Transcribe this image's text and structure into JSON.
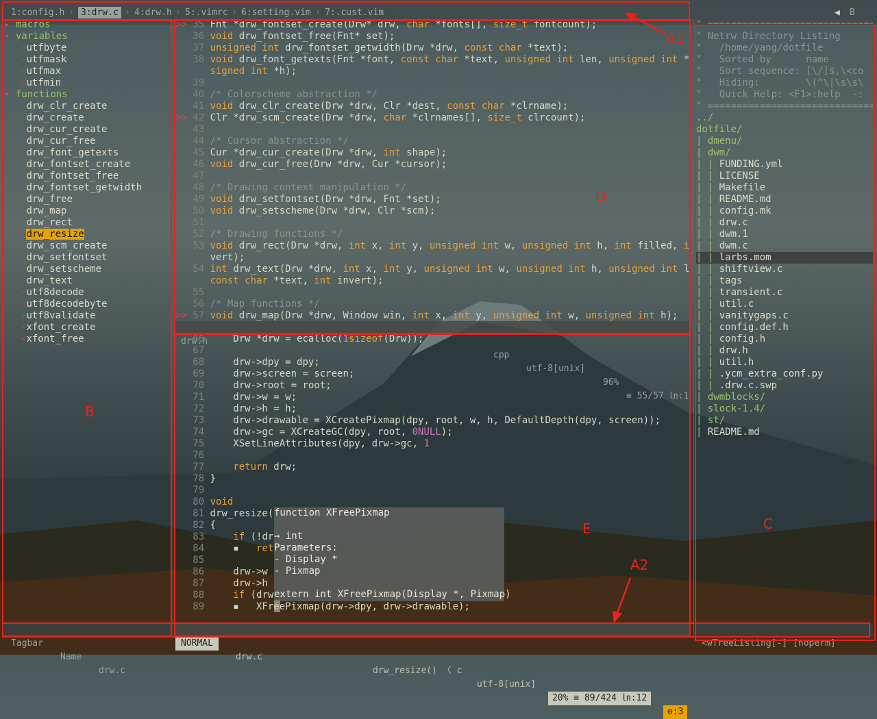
{
  "tabs": [
    {
      "label": "1:config.h",
      "active": false
    },
    {
      "label": "3:drw.c",
      "active": true
    },
    {
      "label": "4:drw.h",
      "active": false
    },
    {
      "label": "5:.vimrc",
      "active": false
    },
    {
      "label": "6:setting.vim",
      "active": false
    },
    {
      "label": "7:.cust.vim",
      "active": false
    }
  ],
  "tab_right": "B",
  "tagbar": {
    "groups": [
      {
        "label": "macros",
        "open": false
      },
      {
        "label": "variables",
        "open": true
      },
      {
        "label": "functions",
        "open": true
      }
    ],
    "variables": [
      "utfbyte",
      "utfmask",
      "utfmax",
      "utfmin"
    ],
    "functions": [
      "drw_clr_create",
      "drw_create",
      "drw_cur_create",
      "drw_cur_free",
      "drw_font_getexts",
      "drw_fontset_create",
      "drw_fontset_free",
      "drw_fontset_getwidth",
      "drw_free",
      "drw_map",
      "drw_rect",
      "drw_resize",
      "drw_scm_create",
      "drw_setfontset",
      "drw_setscheme",
      "drw_text",
      "utf8decode",
      "utf8decodebyte",
      "utf8validate",
      "xfont_create",
      "xfont_free"
    ],
    "highlighted": "drw_resize",
    "status": {
      "name": "Tagbar",
      "label": "Name",
      "file": "drw.c"
    }
  },
  "top_window": {
    "lines": [
      {
        "n": "35",
        "sign": ">>",
        "segs": [
          [
            "",
            "Fnt *drw_fontset_create(Drw* drw, "
          ],
          [
            "kw",
            "char"
          ],
          [
            "",
            " *fonts[], "
          ],
          [
            "kw",
            "size_t"
          ],
          [
            "",
            " fontcount);"
          ]
        ]
      },
      {
        "n": "36",
        "segs": [
          [
            "kw",
            "void"
          ],
          [
            "",
            " drw_fontset_free(Fnt* set);"
          ]
        ]
      },
      {
        "n": "37",
        "segs": [
          [
            "kw",
            "unsigned int"
          ],
          [
            "",
            " drw_fontset_getwidth(Drw *drw, "
          ],
          [
            "kw",
            "const char"
          ],
          [
            "",
            " *text);"
          ]
        ]
      },
      {
        "n": "38",
        "segs": [
          [
            "kw",
            "void"
          ],
          [
            "",
            " drw_font_getexts(Fnt *font, "
          ],
          [
            "kw",
            "const char"
          ],
          [
            "",
            " *text, "
          ],
          [
            "kw",
            "unsigned int"
          ],
          [
            "",
            " len, "
          ],
          [
            "kw",
            "unsigned int"
          ],
          [
            "",
            " *w, un"
          ]
        ]
      },
      {
        "n": "",
        "segs": [
          [
            "kw",
            "signed int"
          ],
          [
            "",
            " *h);"
          ]
        ]
      },
      {
        "n": "39",
        "segs": []
      },
      {
        "n": "40",
        "segs": [
          [
            "cm",
            "/* Colorscheme abstraction */"
          ]
        ]
      },
      {
        "n": "41",
        "segs": [
          [
            "kw",
            "void"
          ],
          [
            "",
            " drw_clr_create(Drw *drw, Clr *dest, "
          ],
          [
            "kw",
            "const char"
          ],
          [
            "",
            " *clrname);"
          ]
        ]
      },
      {
        "n": "42",
        "sign": ">>",
        "segs": [
          [
            "",
            "Clr *drw_scm_create(Drw *drw, "
          ],
          [
            "kw",
            "char"
          ],
          [
            "",
            " *clrnames[], "
          ],
          [
            "kw",
            "size_t"
          ],
          [
            "",
            " clrcount);"
          ]
        ]
      },
      {
        "n": "43",
        "segs": []
      },
      {
        "n": "44",
        "segs": [
          [
            "cm",
            "/* Cursor abstraction */"
          ]
        ]
      },
      {
        "n": "45",
        "segs": [
          [
            "",
            "Cur *drw_cur_create(Drw *drw, "
          ],
          [
            "kw",
            "int"
          ],
          [
            "",
            " shape);"
          ]
        ]
      },
      {
        "n": "46",
        "segs": [
          [
            "kw",
            "void"
          ],
          [
            "",
            " drw_cur_free(Drw *drw, Cur *cursor);"
          ]
        ]
      },
      {
        "n": "47",
        "segs": []
      },
      {
        "n": "48",
        "segs": [
          [
            "cm",
            "/* Drawing context manipulation */"
          ]
        ]
      },
      {
        "n": "49",
        "segs": [
          [
            "kw",
            "void"
          ],
          [
            "",
            " drw_setfontset(Drw *drw, Fnt *set);"
          ]
        ]
      },
      {
        "n": "50",
        "segs": [
          [
            "kw",
            "void"
          ],
          [
            "",
            " drw_setscheme(Drw *drw, Clr *scm);"
          ]
        ]
      },
      {
        "n": "51",
        "segs": []
      },
      {
        "n": "52",
        "segs": [
          [
            "cm",
            "/* Drawing functions */"
          ]
        ]
      },
      {
        "n": "53",
        "segs": [
          [
            "kw",
            "void"
          ],
          [
            "",
            " drw_rect(Drw *drw, "
          ],
          [
            "kw",
            "int"
          ],
          [
            "",
            " x, "
          ],
          [
            "kw",
            "int"
          ],
          [
            "",
            " y, "
          ],
          [
            "kw",
            "unsigned int"
          ],
          [
            "",
            " w, "
          ],
          [
            "kw",
            "unsigned int"
          ],
          [
            "",
            " h, "
          ],
          [
            "kw",
            "int"
          ],
          [
            "",
            " filled, "
          ],
          [
            "kw",
            "int"
          ],
          [
            "",
            " in"
          ]
        ]
      },
      {
        "n": "",
        "segs": [
          [
            "",
            "vert);"
          ]
        ]
      },
      {
        "n": "54",
        "segs": [
          [
            "kw",
            "int"
          ],
          [
            "",
            " drw_text(Drw *drw, "
          ],
          [
            "kw",
            "int"
          ],
          [
            "",
            " x, "
          ],
          [
            "kw",
            "int"
          ],
          [
            "",
            " y, "
          ],
          [
            "kw",
            "unsigned int"
          ],
          [
            "",
            " w, "
          ],
          [
            "kw",
            "unsigned int"
          ],
          [
            "",
            " h, "
          ],
          [
            "kw",
            "unsigned int"
          ],
          [
            "",
            " lpad,"
          ]
        ]
      },
      {
        "n": "",
        "segs": [
          [
            "kw",
            "const char"
          ],
          [
            "",
            " *text, "
          ],
          [
            "kw",
            "int"
          ],
          [
            "",
            " invert);"
          ]
        ]
      },
      {
        "n": "55",
        "segs": []
      },
      {
        "n": "56",
        "segs": [
          [
            "cm",
            "/* Map functions */"
          ]
        ]
      },
      {
        "n": "57",
        "sign": ">>",
        "segs": [
          [
            "kw",
            "void"
          ],
          [
            "",
            " drw_map(Drw *drw, Window win, "
          ],
          [
            "kw",
            "int"
          ],
          [
            "",
            " x, "
          ],
          [
            "kw",
            "int"
          ],
          [
            "",
            " y, "
          ],
          [
            "kw",
            "unsigned int"
          ],
          [
            "",
            " w, "
          ],
          [
            "kw",
            "unsigned int"
          ],
          [
            "",
            " h);"
          ]
        ]
      }
    ],
    "status": {
      "file": "drw.h",
      "ft": "cpp",
      "enc": "utf-8[unix]",
      "pct": "96%",
      "pos": "≡ 55/57 ㏑:1"
    }
  },
  "bottom_window": {
    "lines": [
      {
        "n": "66",
        "segs": [
          [
            "",
            "    Drw *drw = ecalloc("
          ],
          [
            "num",
            "1"
          ],
          [
            ", "
          ],
          [
            "kw",
            "sizeof"
          ],
          [
            "",
            "(Drw));"
          ]
        ]
      },
      {
        "n": "67",
        "segs": []
      },
      {
        "n": "68",
        "segs": [
          [
            "",
            "    drw->dpy = dpy;"
          ]
        ]
      },
      {
        "n": "69",
        "segs": [
          [
            "",
            "    drw->screen = screen;"
          ]
        ]
      },
      {
        "n": "70",
        "segs": [
          [
            "",
            "    drw->root = root;"
          ]
        ]
      },
      {
        "n": "71",
        "segs": [
          [
            "",
            "    drw->w = w;"
          ]
        ]
      },
      {
        "n": "72",
        "segs": [
          [
            "",
            "    drw->h = h;"
          ]
        ]
      },
      {
        "n": "73",
        "segs": [
          [
            "",
            "    drw->drawable = XCreatePixmap(dpy, root, w, h, DefaultDepth(dpy, screen));"
          ]
        ]
      },
      {
        "n": "74",
        "segs": [
          [
            "",
            "    drw->gc = XCreateGC(dpy, root, "
          ],
          [
            "num",
            "0"
          ],
          [
            ", "
          ],
          [
            "num",
            "NULL"
          ],
          [
            "",
            ");"
          ]
        ]
      },
      {
        "n": "75",
        "segs": [
          [
            "",
            "    XSetLineAttributes(dpy, drw->gc, "
          ],
          [
            "num",
            "1"
          ],
          [
            ", LineSolid, CapButt, JoinMiter);"
          ]
        ]
      },
      {
        "n": "76",
        "segs": []
      },
      {
        "n": "77",
        "segs": [
          [
            "",
            "    "
          ],
          [
            "kw",
            "return"
          ],
          [
            "",
            " drw;"
          ]
        ]
      },
      {
        "n": "78",
        "segs": [
          [
            "",
            "}"
          ]
        ]
      },
      {
        "n": "79",
        "segs": []
      },
      {
        "n": "80",
        "segs": [
          [
            "kw",
            "void"
          ]
        ]
      },
      {
        "n": "81",
        "segs": [
          [
            "",
            "drw_resize("
          ]
        ]
      },
      {
        "n": "82",
        "segs": [
          [
            "",
            "{"
          ]
        ]
      },
      {
        "n": "83",
        "segs": [
          [
            "",
            "    "
          ],
          [
            "kw",
            "if"
          ],
          [
            "",
            " (!dr"
          ]
        ]
      },
      {
        "n": "84",
        "segs": [
          [
            "",
            "    ▪   "
          ],
          [
            "kw",
            "ret"
          ]
        ]
      },
      {
        "n": "85",
        "segs": []
      },
      {
        "n": "86",
        "segs": [
          [
            "",
            "    drw->w"
          ]
        ]
      },
      {
        "n": "87",
        "segs": [
          [
            "",
            "    drw->h"
          ]
        ]
      },
      {
        "n": "88",
        "segs": [
          [
            "",
            "    "
          ],
          [
            "kw",
            "if"
          ],
          [
            "",
            " (drw"
          ]
        ]
      },
      {
        "n": "89",
        "segs": [
          [
            "",
            "    ▪   XFreePixmap(drw->dpy, drw->drawable);"
          ]
        ]
      }
    ],
    "popup": [
      "function XFreePixmap",
      "",
      "→ int",
      "Parameters:",
      "- Display *",
      "- Pixmap",
      "",
      "extern int XFreePixmap(Display *, Pixmap)"
    ],
    "status": {
      "mode": "NORMAL",
      "file": "drw.c",
      "func": "drw_resize() 〈 c",
      "enc": "utf-8[unix]",
      "pos": "20% ≡ 89/424 ㏑:12",
      "warn": "⊖:3"
    }
  },
  "netrw": {
    "header": [
      "\" ============================================",
      "\" Netrw Directory Listing",
      "\"   /home/yang/dotfile",
      "\"   Sorted by      name",
      "\"   Sort sequence: [\\/]$,\\<co",
      "\"   Hiding:        \\(^\\|\\s\\s\\",
      "\"   Quick Help: <F1>:help  -:",
      "\" ============================================"
    ],
    "entries": [
      {
        "t": "../",
        "dir": true,
        "depth": 0
      },
      {
        "t": "dotfile/",
        "dir": true,
        "depth": 0
      },
      {
        "t": "dmenu/",
        "dir": true,
        "depth": 1
      },
      {
        "t": "dwm/",
        "dir": true,
        "depth": 1
      },
      {
        "t": "FUNDING.yml",
        "dir": false,
        "depth": 2
      },
      {
        "t": "LICENSE",
        "dir": false,
        "depth": 2
      },
      {
        "t": "Makefile",
        "dir": false,
        "depth": 2
      },
      {
        "t": "README.md",
        "dir": false,
        "depth": 2
      },
      {
        "t": "config.mk",
        "dir": false,
        "depth": 2
      },
      {
        "t": "drw.c",
        "dir": false,
        "depth": 2
      },
      {
        "t": "dwm.1",
        "dir": false,
        "depth": 2
      },
      {
        "t": "dwm.c",
        "dir": false,
        "depth": 2
      },
      {
        "t": "larbs.mom",
        "dir": false,
        "depth": 2,
        "sel": true
      },
      {
        "t": "shiftview.c",
        "dir": false,
        "depth": 2
      },
      {
        "t": "tags",
        "dir": false,
        "depth": 2
      },
      {
        "t": "transient.c",
        "dir": false,
        "depth": 2
      },
      {
        "t": "util.c",
        "dir": false,
        "depth": 2
      },
      {
        "t": "vanitygaps.c",
        "dir": false,
        "depth": 2
      },
      {
        "t": "config.def.h",
        "dir": false,
        "depth": 2
      },
      {
        "t": "config.h",
        "dir": false,
        "depth": 2
      },
      {
        "t": "drw.h",
        "dir": false,
        "depth": 2
      },
      {
        "t": "util.h",
        "dir": false,
        "depth": 2
      },
      {
        "t": ".ycm_extra_conf.py",
        "dir": false,
        "depth": 2
      },
      {
        "t": ".drw.c.swp",
        "dir": false,
        "depth": 2
      },
      {
        "t": "dwmblocks/",
        "dir": true,
        "depth": 1
      },
      {
        "t": "slock-1.4/",
        "dir": true,
        "depth": 1
      },
      {
        "t": "st/",
        "dir": true,
        "depth": 1
      },
      {
        "t": "README.md",
        "dir": false,
        "depth": 1
      }
    ],
    "status": "<wTreeListing[-] [noperm]"
  },
  "annotations": {
    "a1": "A1",
    "a2": "A2",
    "b": "B",
    "c": "C",
    "d": "D",
    "e": "E"
  },
  "colors": {
    "accent": "#e8a300",
    "annot": "#e8231b",
    "status_active": "#c9c9bb"
  }
}
